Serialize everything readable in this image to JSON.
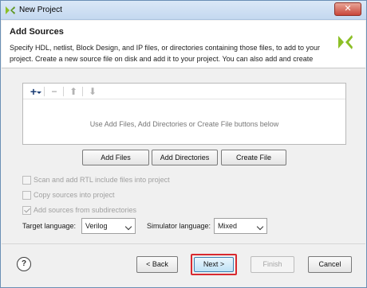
{
  "window": {
    "title": "New Project"
  },
  "header": {
    "title": "Add Sources",
    "description": "Specify HDL, netlist, Block Design, and IP files, or directories containing those files, to add to your project. Create a new source file on disk and add it to your project. You can also add and create"
  },
  "file_panel": {
    "empty_hint": "Use Add Files, Add Directories or Create File buttons below",
    "toolbar": {
      "add_icon": "plus-icon",
      "remove_icon": "minus-icon",
      "up_icon": "arrow-up-icon",
      "down_icon": "arrow-down-icon"
    }
  },
  "buttons": {
    "add_files": "Add Files",
    "add_directories": "Add Directories",
    "create_file": "Create File"
  },
  "options": [
    {
      "label": "Scan and add RTL include files into project",
      "checked": false,
      "enabled": false
    },
    {
      "label": "Copy sources into project",
      "checked": false,
      "enabled": false
    },
    {
      "label": "Add sources from subdirectories",
      "checked": true,
      "enabled": false
    }
  ],
  "languages": {
    "target_label": "Target language:",
    "target_value": "Verilog",
    "simulator_label": "Simulator language:",
    "simulator_value": "Mixed"
  },
  "footer": {
    "help": "?",
    "back": "< Back",
    "next": "Next >",
    "finish": "Finish",
    "cancel": "Cancel"
  },
  "colors": {
    "highlight_border": "#d8292f",
    "brand_logo": "#8cbf26"
  }
}
